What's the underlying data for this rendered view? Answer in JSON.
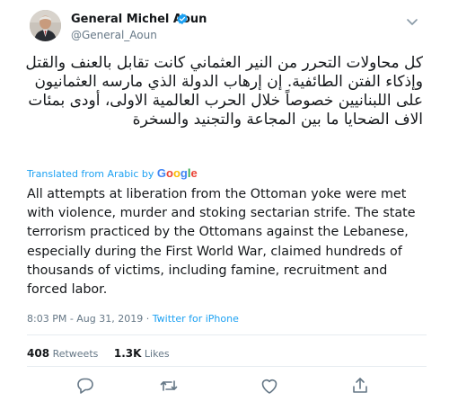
{
  "author": {
    "name": "General Michel Aoun",
    "handle": "@General_Aoun"
  },
  "tweet": {
    "arabic_text": "كل محاولات التحرر من النير العثماني كانت تقابل بالعنف والقتل وإذكاء الفتن الطائفية. إن إرهاب الدولة الذي مارسه العثمانيون على اللبنانيين خصوصاً خلال الحرب العالمية الاولى، أودى بمئات الاف الضحايا ما بين المجاعة والتجنيد والسخرة",
    "translated_label": "Translated from Arabic by",
    "translator": "Google",
    "english_text": "All attempts at liberation from the Ottoman yoke were met with violence, murder and stoking sectarian strife. The state terrorism practiced by the Ottomans against the Lebanese, especially during the First World War, claimed hundreds of thousands of victims, including famine, recruitment and forced labor.",
    "timestamp": "8:03 PM - Aug 31, 2019",
    "separator": " · ",
    "source": "Twitter for iPhone"
  },
  "stats": {
    "retweets_count": "408",
    "retweets_label": "Retweets",
    "likes_count": "1.3K",
    "likes_label": "Likes"
  },
  "colors": {
    "link": "#1da1f2",
    "secondary": "#657786",
    "text": "#14171a",
    "border": "#e6ecf0"
  },
  "icons": [
    "verified-icon",
    "chevron-down-icon",
    "reply-icon",
    "retweet-icon",
    "like-icon",
    "share-icon"
  ]
}
